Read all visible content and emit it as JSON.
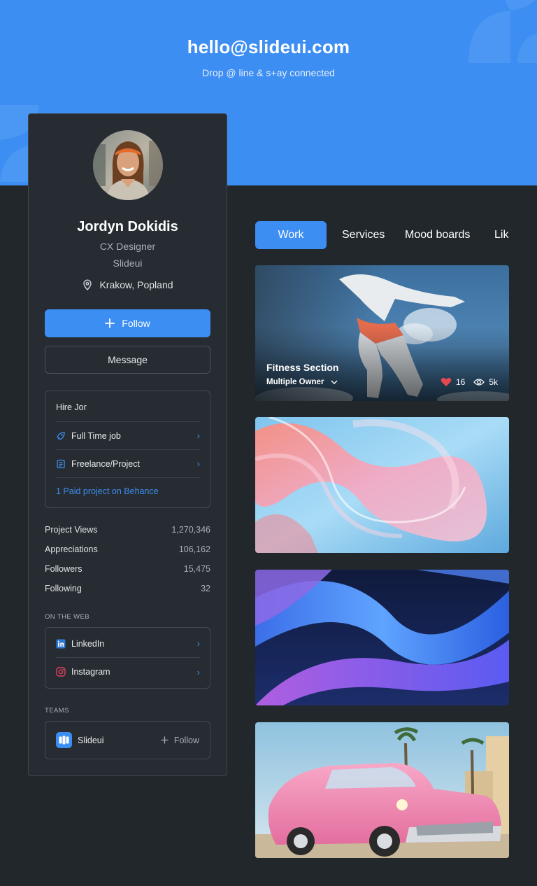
{
  "hero": {
    "email": "hello@slideui.com",
    "tagline": "Drop @ line & s+ay connected"
  },
  "profile": {
    "name": "Jordyn Dokidis",
    "role": "CX Designer",
    "company": "Slideui",
    "location": "Krakow, Popland",
    "follow_label": "Follow",
    "message_label": "Message"
  },
  "hire": {
    "title": "Hire Jor",
    "options": [
      {
        "label": "Full Time job",
        "icon": "rocket-icon"
      },
      {
        "label": "Freelance/Project",
        "icon": "document-icon"
      }
    ],
    "link": "1 Paid project on Behance"
  },
  "stats": [
    {
      "label": "Project Views",
      "value": "1,270,346"
    },
    {
      "label": "Appreciations",
      "value": "106,162"
    },
    {
      "label": "Followers",
      "value": "15,475"
    },
    {
      "label": "Following",
      "value": "32"
    }
  ],
  "web": {
    "heading": "ON THE WEB",
    "links": [
      {
        "label": "LinkedIn",
        "icon": "linkedin-icon"
      },
      {
        "label": "Instagram",
        "icon": "instagram-icon"
      }
    ]
  },
  "teams": {
    "heading": "TEAMS",
    "name": "Slideui",
    "follow_label": "Follow"
  },
  "tabs": [
    {
      "label": "Work",
      "active": true
    },
    {
      "label": "Services",
      "active": false
    },
    {
      "label": "Mood boards",
      "active": false
    },
    {
      "label": "Lik",
      "active": false
    }
  ],
  "projects": [
    {
      "title": "Fitness Section",
      "owner": "Multiple Owner",
      "likes": "16",
      "views": "5k"
    }
  ],
  "colors": {
    "accent": "#3d8ef2",
    "background": "#22272c",
    "card": "#262c31",
    "like": "#e5484d"
  }
}
